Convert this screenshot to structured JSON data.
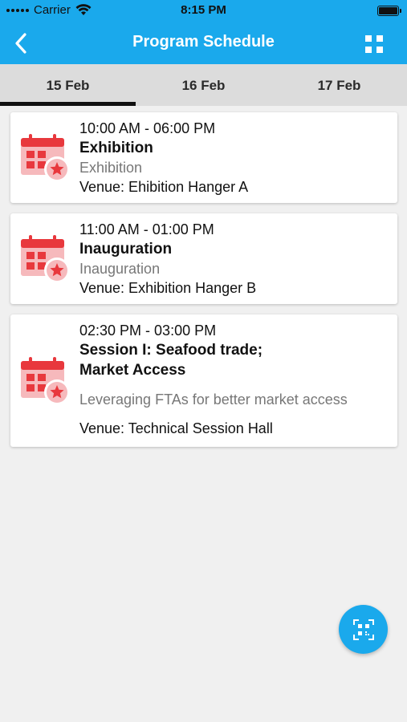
{
  "status": {
    "carrier": "Carrier",
    "time": "8:15 PM"
  },
  "header": {
    "title": "Program Schedule"
  },
  "tabs": [
    {
      "label": "15 Feb",
      "active": true
    },
    {
      "label": "16 Feb",
      "active": false
    },
    {
      "label": "17 Feb",
      "active": false
    }
  ],
  "events": [
    {
      "time": "10:00 AM - 06:00 PM",
      "title": "Exhibition",
      "subtitle": "Exhibition",
      "venue": "Venue: Ehibition Hanger  A"
    },
    {
      "time": "11:00 AM - 01:00 PM",
      "title": "Inauguration",
      "subtitle": "Inauguration",
      "venue": "Venue: Exhibition Hanger B"
    },
    {
      "time": "02:30 PM - 03:00 PM",
      "title_line1": "Session I: Seafood trade;",
      "title_line2": "Market Access",
      "subtitle": "Leveraging FTAs for better market access",
      "venue": "Venue: Technical Session Hall"
    }
  ],
  "colors": {
    "accent": "#1aa9ec",
    "icon_red": "#e8383d",
    "icon_pink": "#f6b9bc"
  },
  "icons": {
    "back": "chevron-left-icon",
    "menu": "grid-icon",
    "event": "calendar-star-icon",
    "fab": "qr-scan-icon"
  }
}
